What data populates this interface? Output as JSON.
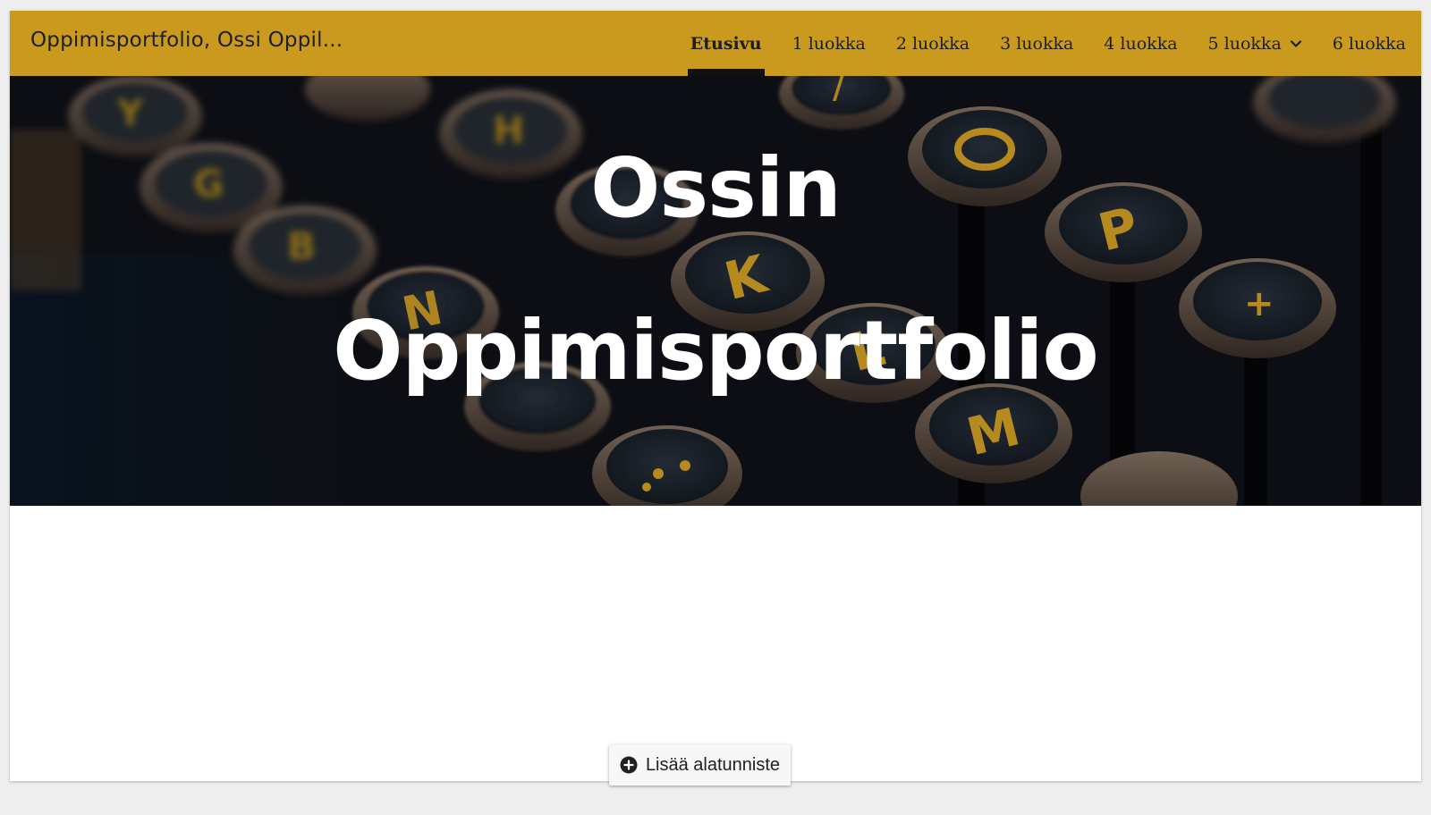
{
  "header": {
    "site_title": "Oppimisportfolio, Ossi Oppil...",
    "nav": [
      {
        "label": "Etusivu",
        "active": true
      },
      {
        "label": "1 luokka"
      },
      {
        "label": "2 luokka"
      },
      {
        "label": "3 luokka"
      },
      {
        "label": "4 luokka"
      },
      {
        "label": "5 luokka",
        "has_dropdown": true
      },
      {
        "label": "6 luokka"
      }
    ],
    "accent_color": "#c99a1e"
  },
  "hero": {
    "line1": "Ossin",
    "line2": "Oppimisportfolio",
    "image_subject": "typewriter-keys-background"
  },
  "footer": {
    "add_footer_label": "Lisää alatunniste",
    "icon": "plus-circle-icon"
  }
}
